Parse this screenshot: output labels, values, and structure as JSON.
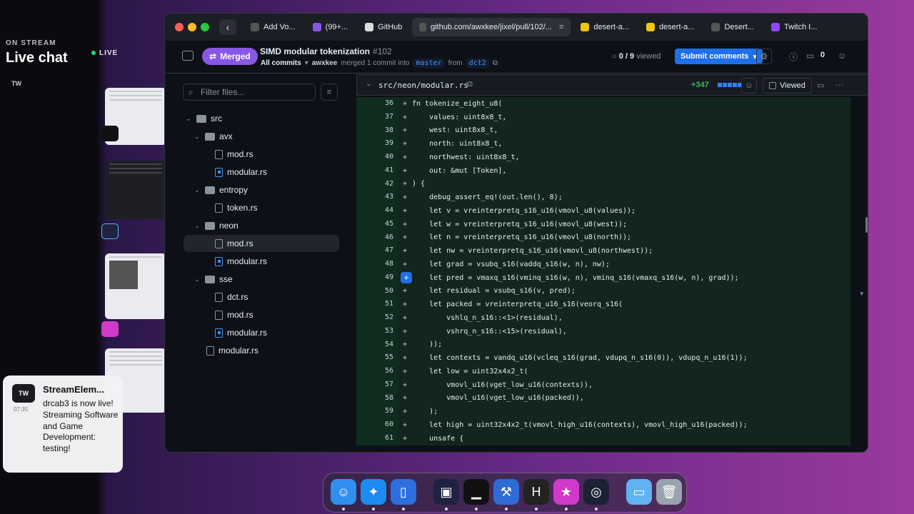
{
  "stream": {
    "on_stream": "ON STREAM",
    "title": "Live chat",
    "live": "LIVE",
    "tw": "TW"
  },
  "notification": {
    "avatar": "TW",
    "time": "07:35",
    "title": "StreamElem...",
    "body": "drcab3 is now live! Streaming Software and Game Development: testing!"
  },
  "browser": {
    "tabs": [
      {
        "label": "Add Vo...",
        "color": "#555"
      },
      {
        "label": "(99+...",
        "color": "#8957e5"
      },
      {
        "label": "GitHub",
        "color": "#ddd"
      },
      {
        "label": "github.com/awxkee/jixel/pull/102/...",
        "color": "#555",
        "active": true
      },
      {
        "label": "desert-a...",
        "color": "#f1c40f"
      },
      {
        "label": "desert-a...",
        "color": "#f1c40f"
      },
      {
        "label": "Desert...",
        "color": "#555"
      },
      {
        "label": "Twitch I...",
        "color": "#9146ff"
      }
    ]
  },
  "pr": {
    "status": "Merged",
    "title": "SIMD modular tokenization",
    "number": "#102",
    "all_commits": "All commits",
    "user": "awxkee",
    "merged_text": "merged 1 commit into",
    "base": "master",
    "from": "from",
    "head": "dct2",
    "viewed": "0 / 9",
    "viewed_label": "viewed",
    "submit": "Submit comments",
    "comments": "0"
  },
  "sidebar": {
    "filter_placeholder": "Filter files...",
    "tree": [
      {
        "label": "src",
        "type": "folder",
        "depth": 0
      },
      {
        "label": "avx",
        "type": "folder",
        "depth": 1
      },
      {
        "label": "mod.rs",
        "type": "file",
        "depth": 2
      },
      {
        "label": "modular.rs",
        "type": "file-mod",
        "depth": 2
      },
      {
        "label": "entropy",
        "type": "folder",
        "depth": 1
      },
      {
        "label": "token.rs",
        "type": "file",
        "depth": 2
      },
      {
        "label": "neon",
        "type": "folder",
        "depth": 1
      },
      {
        "label": "mod.rs",
        "type": "file",
        "depth": 2,
        "selected": true
      },
      {
        "label": "modular.rs",
        "type": "file-mod",
        "depth": 2
      },
      {
        "label": "sse",
        "type": "folder",
        "depth": 1
      },
      {
        "label": "dct.rs",
        "type": "file",
        "depth": 2
      },
      {
        "label": "mod.rs",
        "type": "file",
        "depth": 2
      },
      {
        "label": "modular.rs",
        "type": "file-mod",
        "depth": 2
      },
      {
        "label": "modular.rs",
        "type": "file",
        "depth": 1
      }
    ]
  },
  "diff": {
    "path": "src/neon/modular.rs",
    "additions": "+347",
    "viewed": "Viewed",
    "lines": [
      {
        "n": "36",
        "t": "fn tokenize_eight_u8("
      },
      {
        "n": "37",
        "t": "    values: uint8x8_t,"
      },
      {
        "n": "38",
        "t": "    west: uint8x8_t,"
      },
      {
        "n": "39",
        "t": "    north: uint8x8_t,"
      },
      {
        "n": "40",
        "t": "    northwest: uint8x8_t,"
      },
      {
        "n": "41",
        "t": "    out: &mut [Token],"
      },
      {
        "n": "42",
        "t": ") {"
      },
      {
        "n": "43",
        "t": "    debug_assert_eq!(out.len(), 8);"
      },
      {
        "n": "44",
        "t": "    let v = vreinterpretq_s16_u16(vmovl_u8(values));"
      },
      {
        "n": "45",
        "t": "    let w = vreinterpretq_s16_u16(vmovl_u8(west));"
      },
      {
        "n": "46",
        "t": "    let n = vreinterpretq_s16_u16(vmovl_u8(north));"
      },
      {
        "n": "47",
        "t": "    let nw = vreinterpretq_s16_u16(vmovl_u8(northwest));"
      },
      {
        "n": "48",
        "t": "    let grad = vsubq_s16(vaddq_s16(w, n), nw);"
      },
      {
        "n": "49",
        "t": "    let pred = vmaxq_s16(vminq_s16(w, n), vminq_s16(vmaxq_s16(w, n), grad));"
      },
      {
        "n": "50",
        "t": "    let residual = vsubq_s16(v, pred);"
      },
      {
        "n": "51",
        "t": "    let packed = vreinterpretq_u16_s16(veorq_s16("
      },
      {
        "n": "52",
        "t": "        vshlq_n_s16::<1>(residual),"
      },
      {
        "n": "53",
        "t": "        vshrq_n_s16::<15>(residual),"
      },
      {
        "n": "54",
        "t": "    ));"
      },
      {
        "n": "55",
        "t": "    let contexts = vandq_u16(vcleq_s16(grad, vdupq_n_s16(0)), vdupq_n_u16(1));"
      },
      {
        "n": "56",
        "t": "    let low = uint32x4x2_t("
      },
      {
        "n": "57",
        "t": "        vmovl_u16(vget_low_u16(contexts)),"
      },
      {
        "n": "58",
        "t": "        vmovl_u16(vget_low_u16(packed)),"
      },
      {
        "n": "59",
        "t": "    );"
      },
      {
        "n": "60",
        "t": "    let high = uint32x4x2_t(vmovl_high_u16(contexts), vmovl_high_u16(packed));"
      },
      {
        "n": "61",
        "t": "    unsafe {"
      }
    ]
  },
  "dock": [
    {
      "name": "finder-icon",
      "color": "#2f8ff0",
      "glyph": "☺"
    },
    {
      "name": "safari-icon",
      "color": "#1c8cf2",
      "glyph": "✦"
    },
    {
      "name": "app-icon-blue",
      "color": "#2d6fdf",
      "glyph": "▯"
    },
    {
      "name": "app-icon-dark",
      "color": "#1d2340",
      "glyph": "▣"
    },
    {
      "name": "activity-monitor-icon",
      "color": "#111",
      "glyph": "▁"
    },
    {
      "name": "xcode-icon",
      "color": "#2f6bd6",
      "glyph": "⚒"
    },
    {
      "name": "h-app-icon",
      "color": "#222",
      "glyph": "H"
    },
    {
      "name": "star-app-icon",
      "color": "#d13ac9",
      "glyph": "★"
    },
    {
      "name": "network-icon",
      "color": "#1a2233",
      "glyph": "◎"
    },
    {
      "name": "folder-icon",
      "color": "#5fb3f0",
      "glyph": "▭"
    },
    {
      "name": "trash-icon",
      "color": "#9aa3ad",
      "glyph": "🗑"
    }
  ]
}
